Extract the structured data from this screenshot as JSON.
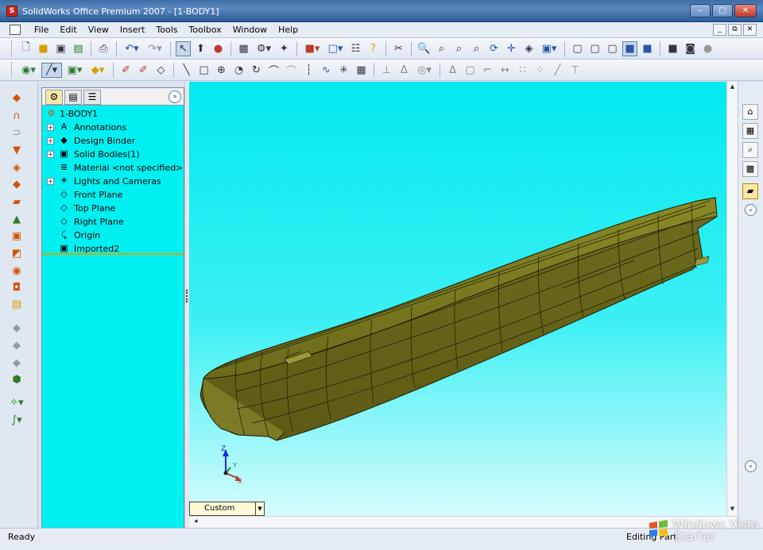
{
  "window": {
    "title": "SolidWorks Office Premium 2007 - [1-BODY1]",
    "minimize_glyph": "–",
    "maximize_glyph": "□",
    "close_glyph": "✕"
  },
  "menu": [
    "File",
    "Edit",
    "View",
    "Insert",
    "Tools",
    "Toolbox",
    "Window",
    "Help"
  ],
  "mdi": {
    "minimize": "_",
    "restore": "⧉",
    "close": "✕"
  },
  "feature_manager": {
    "root": "1-BODY1",
    "tab_icons": [
      "⚙",
      "▤",
      "☰"
    ],
    "expand_glyph": "»",
    "items": [
      {
        "label": "Annotations",
        "icon": "A",
        "icon_name": "annotations-icon",
        "expandable": true
      },
      {
        "label": "Design Binder",
        "icon": "◆",
        "icon_name": "design-binder-icon",
        "expandable": true
      },
      {
        "label": "Solid Bodies(1)",
        "icon": "▣",
        "icon_name": "solid-bodies-icon",
        "expandable": true
      },
      {
        "label": "Material <not specified>",
        "icon": "≣",
        "icon_name": "material-icon",
        "expandable": false
      },
      {
        "label": "Lights and Cameras",
        "icon": "☀",
        "icon_name": "lights-cameras-icon",
        "expandable": true
      },
      {
        "label": "Front Plane",
        "icon": "◇",
        "icon_name": "plane-icon",
        "expandable": false
      },
      {
        "label": "Top Plane",
        "icon": "◇",
        "icon_name": "plane-icon",
        "expandable": false
      },
      {
        "label": "Right Plane",
        "icon": "◇",
        "icon_name": "plane-icon",
        "expandable": false
      },
      {
        "label": "Origin",
        "icon": "⤹",
        "icon_name": "origin-icon",
        "expandable": false
      },
      {
        "label": "Imported2",
        "icon": "▣",
        "icon_name": "imported-feature-icon",
        "expandable": false
      }
    ]
  },
  "graphics": {
    "view_orientation": "Custom",
    "triad": {
      "z": "Z",
      "y": "Y",
      "x": "X"
    },
    "model_color": "#6b6a1c",
    "background_top": "#00eaf0",
    "background_bottom": "#d6fcfd"
  },
  "status": {
    "left": "Ready",
    "right": "Editing Part"
  },
  "watermark": {
    "line1": "Windows Vista",
    "line2": "Starter"
  }
}
